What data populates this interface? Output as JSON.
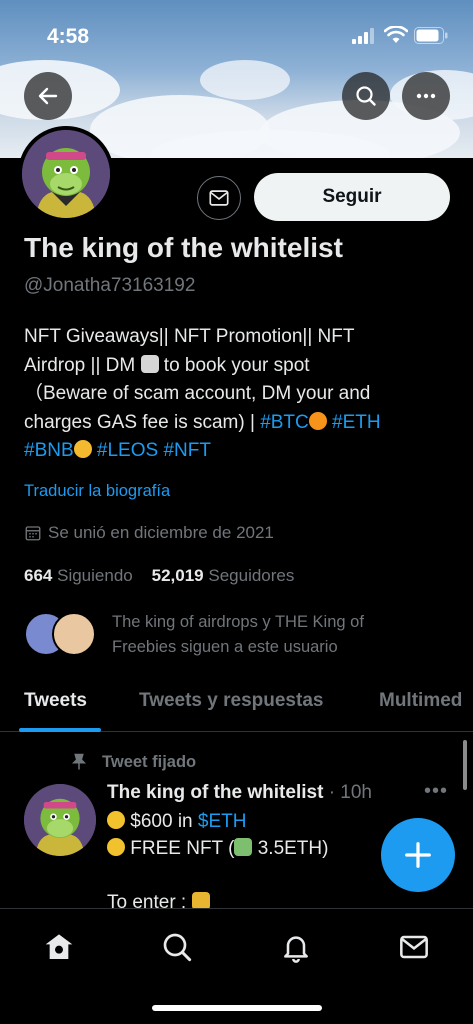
{
  "status_bar": {
    "time": "4:58"
  },
  "profile": {
    "name": "The king of the whitelist",
    "handle": "@Jonatha73163192",
    "follow_label": "Seguir",
    "bio": {
      "line1": "NFT Giveaways|| NFT Promotion|| NFT",
      "line2a": "Airdrop || DM",
      "line2b": "to book your spot",
      "line3": "（Beware of scam account, DM your and",
      "line4a": "charges GAS fee is scam) |",
      "tag_btc": "#BTC",
      "tag_eth": "#ETH",
      "tag_bnb": "#BNB",
      "tag_leos": "#LEOS",
      "tag_nft": "#NFT"
    },
    "translate_label": "Traducir la biografía",
    "joined": "Se unió en diciembre de 2021",
    "following_count": "664",
    "following_label": "Siguiendo",
    "followers_count": "52,019",
    "followers_label": "Seguidores",
    "known_followers_text": "The king of airdrops y THE King of Freebies siguen a este usuario"
  },
  "tabs": [
    {
      "label": "Tweets",
      "active": true
    },
    {
      "label": "Tweets y respuestas",
      "active": false
    },
    {
      "label": "Multimedia",
      "active": false
    }
  ],
  "tabs_visible": {
    "t0": "Tweets",
    "t1": "Tweets y respuestas",
    "t2": "Multimed"
  },
  "pinned_tweet": {
    "pinned_label": "Tweet fijado",
    "author": "The king of the whitelist",
    "meta": "· 10h",
    "line1a": "$600 in",
    "line1b": "$ETH",
    "line2a": "FREE NFT (",
    "line2b": "3.5ETH)",
    "line3": "To enter :"
  },
  "colors": {
    "accent": "#1d9bf0",
    "background": "#000000",
    "muted": "#71767b",
    "text": "#e7e9ea"
  },
  "icons": [
    "back-arrow-icon",
    "search-icon",
    "more-icon",
    "mail-icon",
    "calendar-icon",
    "pin-icon",
    "home-icon",
    "bell-icon",
    "plus-icon"
  ]
}
